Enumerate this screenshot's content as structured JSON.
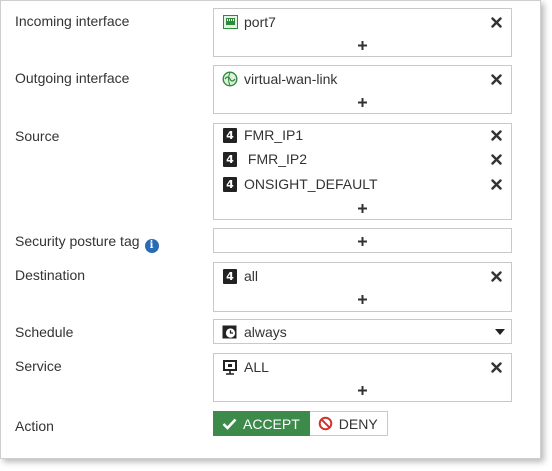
{
  "form": {
    "incoming": {
      "label": "Incoming interface",
      "entries": [
        {
          "text": "port7",
          "icon": "port-icon"
        }
      ]
    },
    "outgoing": {
      "label": "Outgoing interface",
      "entries": [
        {
          "text": "virtual-wan-link",
          "icon": "sd-wan-icon"
        }
      ]
    },
    "source": {
      "label": "Source",
      "entries": [
        {
          "text": "FMR_IP1",
          "icon": "ipv4-address-icon"
        },
        {
          "text": " FMR_IP2",
          "icon": "ipv4-address-icon"
        },
        {
          "text": "ONSIGHT_DEFAULT",
          "icon": "ipv4-address-icon"
        }
      ]
    },
    "posture": {
      "label": "Security posture tag",
      "entries": []
    },
    "destination": {
      "label": "Destination",
      "entries": [
        {
          "text": "all",
          "icon": "ipv4-address-icon"
        }
      ]
    },
    "schedule": {
      "label": "Schedule",
      "value": "always",
      "icon": "schedule-icon"
    },
    "service": {
      "label": "Service",
      "entries": [
        {
          "text": "ALL",
          "icon": "service-icon"
        }
      ]
    },
    "action": {
      "label": "Action",
      "accept_label": "ACCEPT",
      "deny_label": "DENY",
      "selected": "ACCEPT"
    }
  },
  "colors": {
    "accept_bg": "#3c8b4a",
    "deny_icon": "#d0342c",
    "info_icon": "#2a6bb5",
    "port_icon": "#2e8b3a"
  }
}
